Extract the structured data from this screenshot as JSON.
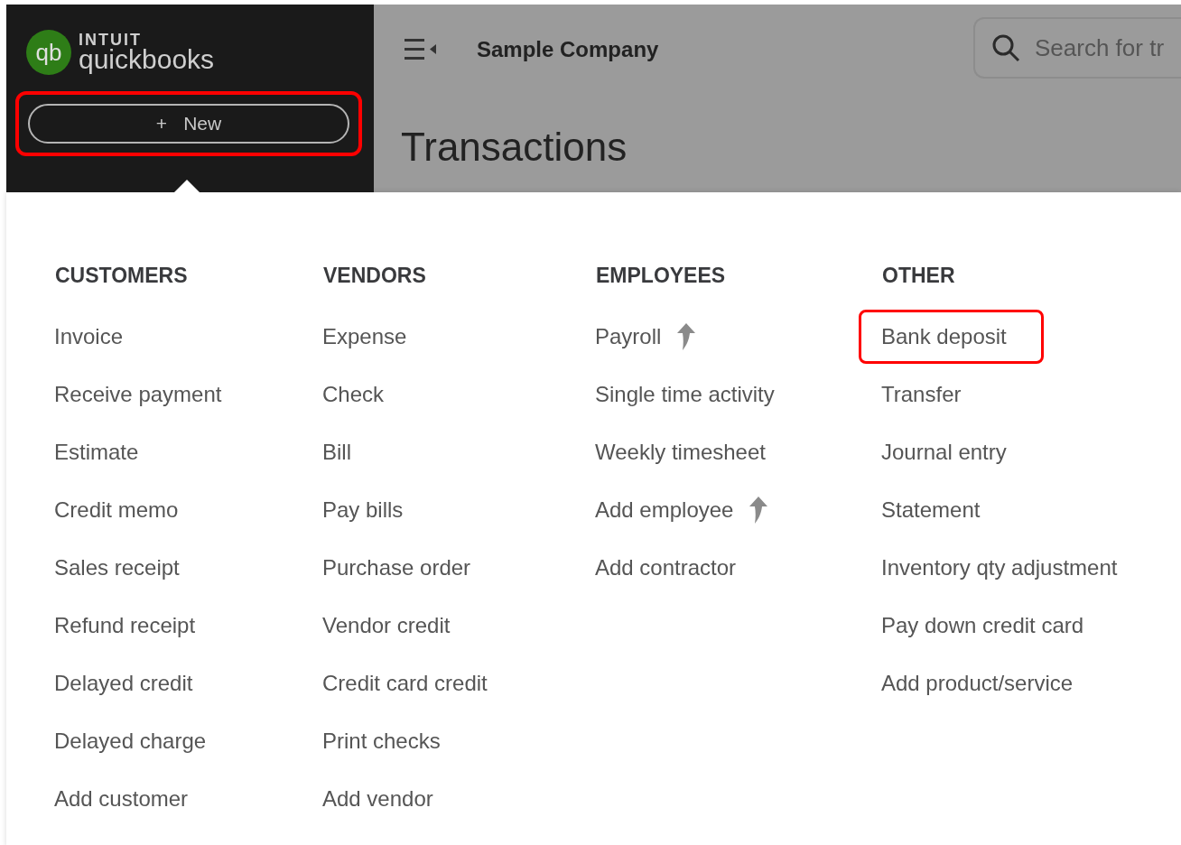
{
  "brand": {
    "top": "INTUIT",
    "name": "quickbooks",
    "mark": "qb"
  },
  "new_button": {
    "icon": "+",
    "label": "New",
    "highlighted": true
  },
  "header": {
    "company": "Sample Company",
    "search": {
      "placeholder": "Search for tr"
    }
  },
  "page_title": "Transactions",
  "menu": {
    "columns": [
      {
        "heading": "CUSTOMERS",
        "items": [
          {
            "label": "Invoice",
            "upgrade": false,
            "highlighted": false
          },
          {
            "label": "Receive payment",
            "upgrade": false,
            "highlighted": false
          },
          {
            "label": "Estimate",
            "upgrade": false,
            "highlighted": false
          },
          {
            "label": "Credit memo",
            "upgrade": false,
            "highlighted": false
          },
          {
            "label": "Sales receipt",
            "upgrade": false,
            "highlighted": false
          },
          {
            "label": "Refund receipt",
            "upgrade": false,
            "highlighted": false
          },
          {
            "label": "Delayed credit",
            "upgrade": false,
            "highlighted": false
          },
          {
            "label": "Delayed charge",
            "upgrade": false,
            "highlighted": false
          },
          {
            "label": "Add customer",
            "upgrade": false,
            "highlighted": false
          }
        ]
      },
      {
        "heading": "VENDORS",
        "items": [
          {
            "label": "Expense",
            "upgrade": false,
            "highlighted": false
          },
          {
            "label": "Check",
            "upgrade": false,
            "highlighted": false
          },
          {
            "label": "Bill",
            "upgrade": false,
            "highlighted": false
          },
          {
            "label": "Pay bills",
            "upgrade": false,
            "highlighted": false
          },
          {
            "label": "Purchase order",
            "upgrade": false,
            "highlighted": false
          },
          {
            "label": "Vendor credit",
            "upgrade": false,
            "highlighted": false
          },
          {
            "label": "Credit card credit",
            "upgrade": false,
            "highlighted": false
          },
          {
            "label": "Print checks",
            "upgrade": false,
            "highlighted": false
          },
          {
            "label": "Add vendor",
            "upgrade": false,
            "highlighted": false
          }
        ]
      },
      {
        "heading": "EMPLOYEES",
        "items": [
          {
            "label": "Payroll",
            "upgrade": true,
            "highlighted": false
          },
          {
            "label": "Single time activity",
            "upgrade": false,
            "highlighted": false
          },
          {
            "label": "Weekly timesheet",
            "upgrade": false,
            "highlighted": false
          },
          {
            "label": "Add employee",
            "upgrade": true,
            "highlighted": false
          },
          {
            "label": "Add contractor",
            "upgrade": false,
            "highlighted": false
          }
        ]
      },
      {
        "heading": "OTHER",
        "items": [
          {
            "label": "Bank deposit",
            "upgrade": false,
            "highlighted": true
          },
          {
            "label": "Transfer",
            "upgrade": false,
            "highlighted": false
          },
          {
            "label": "Journal entry",
            "upgrade": false,
            "highlighted": false
          },
          {
            "label": "Statement",
            "upgrade": false,
            "highlighted": false
          },
          {
            "label": "Inventory qty adjustment",
            "upgrade": false,
            "highlighted": false
          },
          {
            "label": "Pay down credit card",
            "upgrade": false,
            "highlighted": false
          },
          {
            "label": "Add product/service",
            "upgrade": false,
            "highlighted": false
          }
        ]
      }
    ]
  }
}
